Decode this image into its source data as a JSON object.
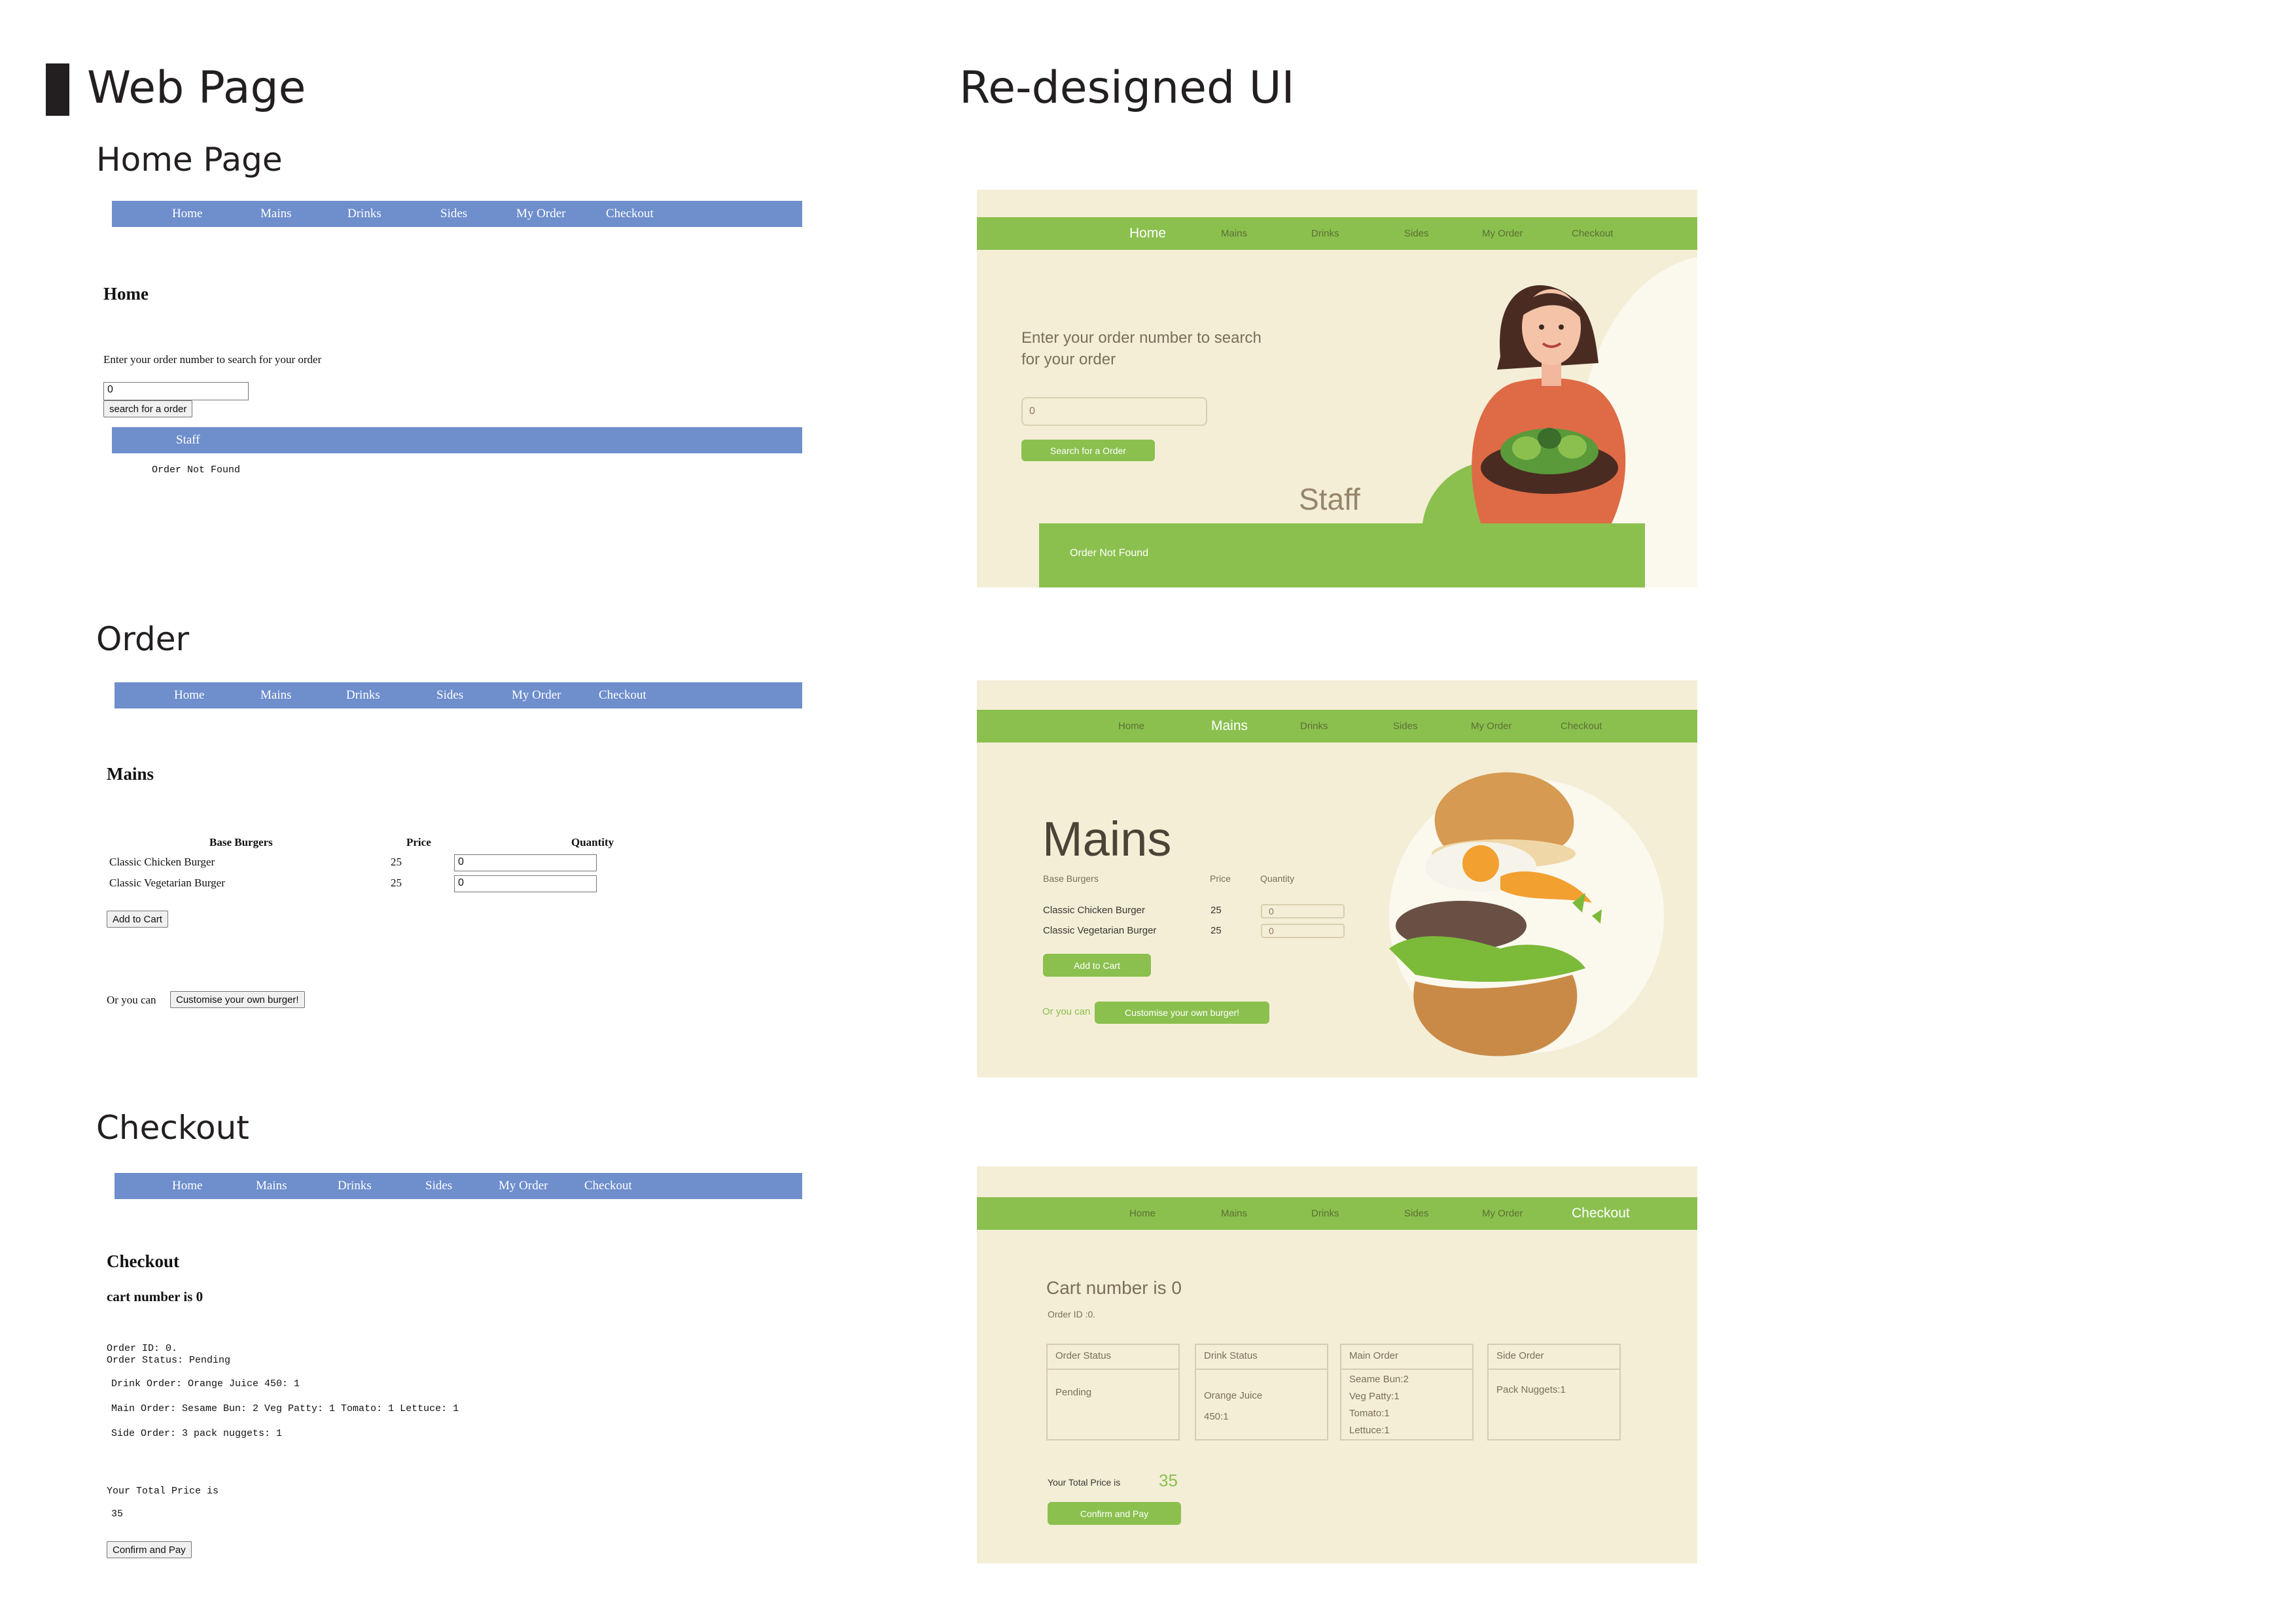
{
  "section_titles": {
    "web_page": "Web Page",
    "redesigned": "Re-designed UI",
    "home_page": "Home Page",
    "order": "Order",
    "checkout": "Checkout"
  },
  "colors": {
    "old_nav": "#6e8ecc",
    "new_nav": "#8bc04f",
    "panel_bg": "#f4eed7",
    "text_dark": "#231f20"
  },
  "nav_items": [
    "Home",
    "Mains",
    "Drinks",
    "Sides",
    "My Order",
    "Checkout"
  ],
  "old_home": {
    "title": "Home",
    "prompt": "Enter your order number to search for your order",
    "input_value": "0",
    "search_button": "search for a order",
    "staff_bar": "Staff",
    "result": "Order Not Found"
  },
  "old_order": {
    "title": "Mains",
    "headers": [
      "Base Burgers",
      "Price",
      "Quantity"
    ],
    "rows": [
      {
        "name": "Classic Chicken Burger",
        "price": "25",
        "qty": "0"
      },
      {
        "name": "Classic Vegetarian Burger",
        "price": "25",
        "qty": "0"
      }
    ],
    "add_button": "Add to Cart",
    "or_text": "Or you can",
    "custom_button": "Customise your own burger!"
  },
  "old_checkout": {
    "title": "Checkout",
    "cart": "cart number is 0",
    "order_id": "Order ID: 0.",
    "order_status": "Order Status: Pending",
    "drink_order": "Drink Order: Orange Juice 450: 1",
    "main_order": "Main Order: Sesame Bun: 2 Veg Patty: 1 Tomato: 1 Lettuce: 1",
    "side_order": "Side Order: 3 pack nuggets: 1",
    "total_label": "Your Total Price is",
    "total_value": "35",
    "confirm_button": "Confirm and Pay"
  },
  "new_home": {
    "prompt": "Enter your order number to search for your order",
    "input_value": "0",
    "search_button": "Search for a Order",
    "staff": "Staff",
    "result": "Order Not Found"
  },
  "new_order": {
    "title": "Mains",
    "headers": [
      "Base Burgers",
      "Price",
      "Quantity"
    ],
    "rows": [
      {
        "name": "Classic Chicken Burger",
        "price": "25",
        "qty": "0"
      },
      {
        "name": "Classic Vegetarian Burger",
        "price": "25",
        "qty": "0"
      }
    ],
    "add_button": "Add to Cart",
    "or_text": "Or you can",
    "custom_button": "Customise your own burger!"
  },
  "new_checkout": {
    "cart": "Cart number is 0",
    "order_id": "Order ID :0.",
    "cards": [
      {
        "head": "Order Status",
        "body": "Pending"
      },
      {
        "head": "Drink Status",
        "body": "Orange Juice\n450:1"
      },
      {
        "head": "Main Order",
        "body": "Seame Bun:2\nVeg Patty:1\nTomato:1\nLettuce:1"
      },
      {
        "head": "Side Order",
        "body": "Pack Nuggets:1"
      }
    ],
    "total_label": "Your Total Price is",
    "total_value": "35",
    "confirm_button": "Confirm and Pay"
  }
}
